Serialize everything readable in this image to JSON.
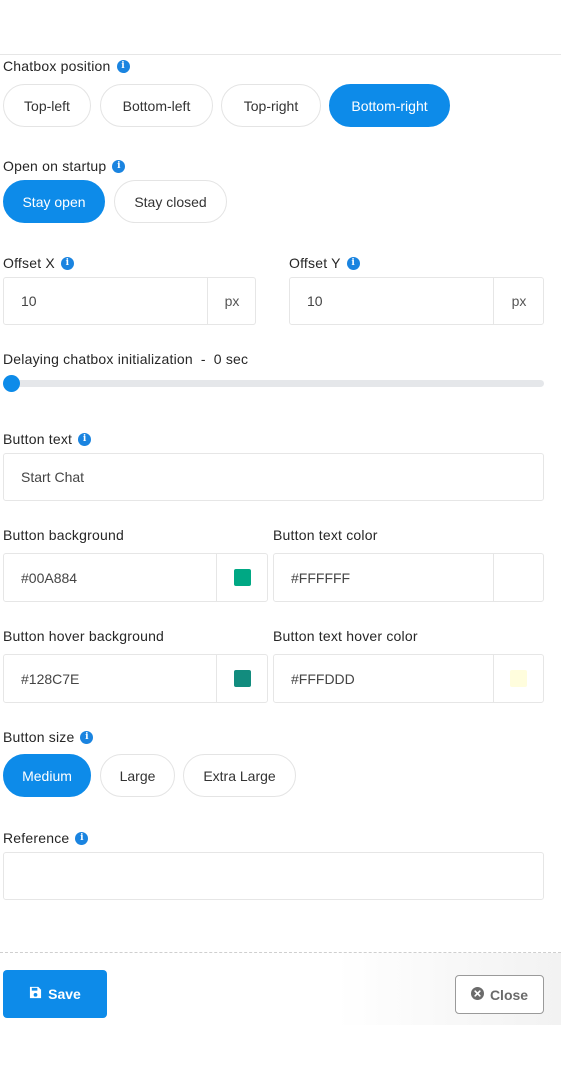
{
  "chatbox_position": {
    "label": "Chatbox position",
    "options": [
      "Top-left",
      "Bottom-left",
      "Top-right",
      "Bottom-right"
    ],
    "selected": "Bottom-right"
  },
  "open_on_startup": {
    "label": "Open on startup",
    "options": [
      "Stay open",
      "Stay closed"
    ],
    "selected": "Stay open"
  },
  "offset_x": {
    "label": "Offset X",
    "value": "10",
    "unit": "px"
  },
  "offset_y": {
    "label": "Offset Y",
    "value": "10",
    "unit": "px"
  },
  "delay": {
    "label": "Delaying chatbox initialization",
    "separator": "-",
    "value_text": "0 sec",
    "value": 0
  },
  "button_text": {
    "label": "Button text",
    "value": "Start Chat"
  },
  "button_background": {
    "label": "Button background",
    "value": "#00A884",
    "swatch": "#00A884"
  },
  "button_text_color": {
    "label": "Button text color",
    "value": "#FFFFFF",
    "swatch": "#FFFFFF"
  },
  "button_hover_background": {
    "label": "Button hover background",
    "value": "#128C7E",
    "swatch": "#128C7E"
  },
  "button_text_hover_color": {
    "label": "Button text hover color",
    "value": "#FFFDDD",
    "swatch": "#FFFDDD"
  },
  "button_size": {
    "label": "Button size",
    "options": [
      "Medium",
      "Large",
      "Extra Large"
    ],
    "selected": "Medium"
  },
  "reference": {
    "label": "Reference",
    "value": ""
  },
  "footer": {
    "save_label": "Save",
    "close_label": "Close"
  },
  "colors": {
    "accent": "#0D8BE9",
    "info_icon": "#1A84E0"
  },
  "icons": {
    "info": "info-icon",
    "save": "floppy-disk-icon",
    "close": "close-circle-icon"
  }
}
